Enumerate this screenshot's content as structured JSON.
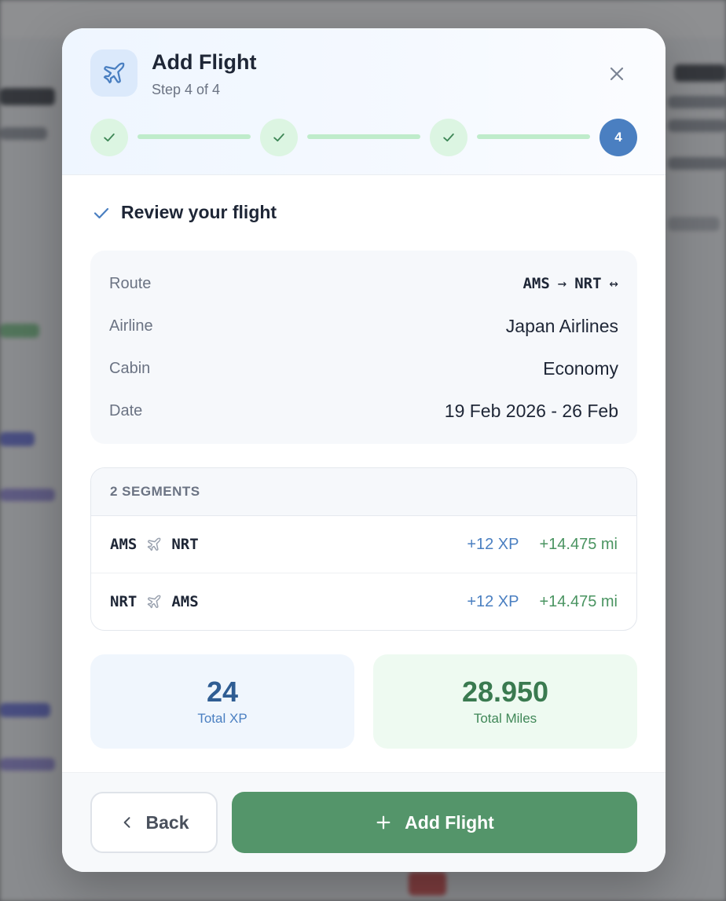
{
  "header": {
    "title": "Add Flight",
    "step": "Step 4 of 4",
    "current_step": "4"
  },
  "review": {
    "title": "Review your flight"
  },
  "summary": {
    "route_label": "Route",
    "route_from": "AMS",
    "route_arrow": "→",
    "route_to": "NRT",
    "route_roundtrip": "↔",
    "airline_label": "Airline",
    "airline_value": "Japan Airlines",
    "cabin_label": "Cabin",
    "cabin_value": "Economy",
    "date_label": "Date",
    "date_value": "19 Feb 2026 - 26 Feb"
  },
  "segments": {
    "heading": "2 SEGMENTS",
    "items": [
      {
        "from": "AMS",
        "to": "NRT",
        "xp": "+12 XP",
        "miles": "+14.475 mi"
      },
      {
        "from": "NRT",
        "to": "AMS",
        "xp": "+12 XP",
        "miles": "+14.475 mi"
      }
    ]
  },
  "totals": {
    "xp_value": "24",
    "xp_label": "Total XP",
    "miles_value": "28.950",
    "miles_label": "Total Miles"
  },
  "footer": {
    "back_label": "Back",
    "add_label": "Add Flight"
  },
  "colors": {
    "accent_blue": "#4a7fc1",
    "accent_green": "#54956a",
    "done_step": "#dcf5e2"
  }
}
